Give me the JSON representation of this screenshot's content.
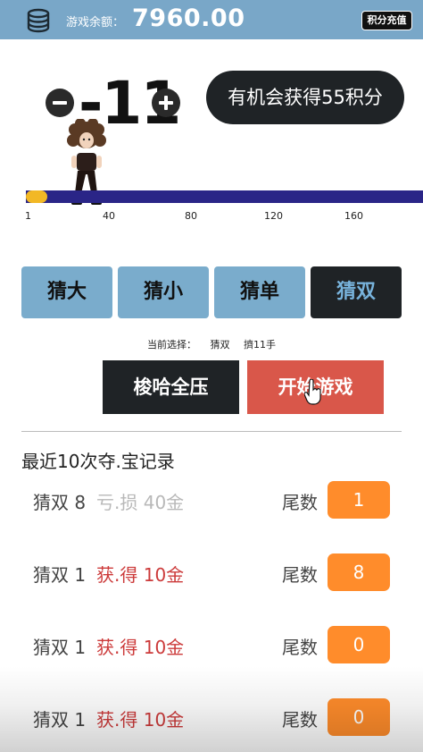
{
  "header": {
    "balance_label": "游戏余额：",
    "balance_value": "7960.00",
    "recharge_label": "积分充值",
    "coin_icon": "coin-stack-icon"
  },
  "bet": {
    "value": "-11",
    "minus_icon": "minus-icon",
    "plus_icon": "plus-icon"
  },
  "promo": {
    "text": "有机会获得55积分"
  },
  "slider": {
    "ticks": [
      "1",
      "40",
      "80",
      "120",
      "160"
    ],
    "knob_color": "#f2b825",
    "track_color": "#2a2587"
  },
  "guess_options": {
    "big": "猜大",
    "small": "猜小",
    "odd": "猜单",
    "even": "猜双",
    "selected": "猜双"
  },
  "selection": {
    "label": "当前选择：",
    "choice": "猜双",
    "hands": "擠11手"
  },
  "actions": {
    "all_in": "梭哈全压",
    "start": "开始游戏"
  },
  "records": {
    "title": "最近10次夺.宝记录",
    "tail_label": "尾数",
    "items": [
      {
        "guess": "猜双 8",
        "result": "亏.损 40金",
        "outcome": "loss",
        "tail": "1"
      },
      {
        "guess": "猜双 1",
        "result": "获.得 10金",
        "outcome": "win",
        "tail": "8"
      },
      {
        "guess": "猜双 1",
        "result": "获.得 10金",
        "outcome": "win",
        "tail": "0"
      },
      {
        "guess": "猜双 1",
        "result": "获.得 10金",
        "outcome": "win",
        "tail": "0"
      }
    ]
  },
  "colors": {
    "header_bg": "#79a7c8",
    "guess_btn": "#7aaccc",
    "selected_btn": "#1f2326",
    "start_btn": "#d9574a",
    "badge": "#ff8c2b",
    "win_text": "#cc3a3a",
    "loss_text": "#b8b8b8"
  }
}
